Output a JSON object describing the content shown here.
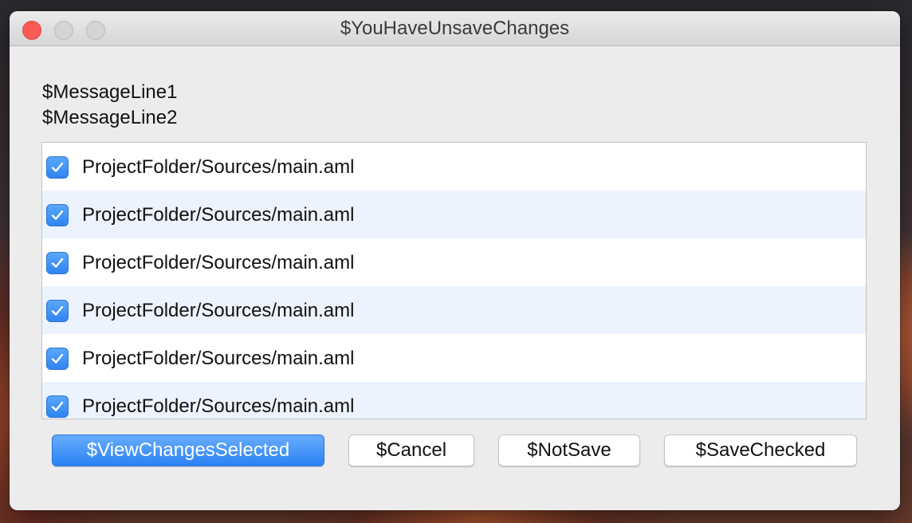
{
  "window": {
    "title": "$YouHaveUnsaveChanges"
  },
  "messages": {
    "line1": "$MessageLine1",
    "line2": "$MessageLine2"
  },
  "files": [
    {
      "path": "ProjectFolder/Sources/main.aml",
      "checked": true
    },
    {
      "path": "ProjectFolder/Sources/main.aml",
      "checked": true
    },
    {
      "path": "ProjectFolder/Sources/main.aml",
      "checked": true
    },
    {
      "path": "ProjectFolder/Sources/main.aml",
      "checked": true
    },
    {
      "path": "ProjectFolder/Sources/main.aml",
      "checked": true
    },
    {
      "path": "ProjectFolder/Sources/main.aml",
      "checked": true
    }
  ],
  "buttons": {
    "view_changes": "$ViewChangesSelected",
    "cancel": "$Cancel",
    "not_save": "$NotSave",
    "save_checked": "$SaveChecked"
  },
  "colors": {
    "accent": "#2f84f2",
    "close": "#fc5b57"
  }
}
